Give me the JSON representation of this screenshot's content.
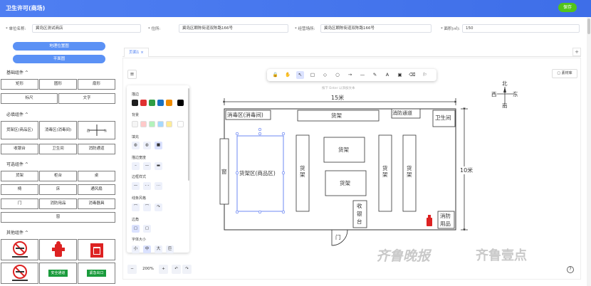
{
  "header": {
    "title": "卫生许可(商场)",
    "save_label": "保存"
  },
  "form": {
    "unit_label": "* 单位名称:",
    "unit_value": "冀岛区测试商店",
    "address_label": "* 住所:",
    "address_value": "冀岛区颗陈街道双陈路166号",
    "business_label": "* 经营场所:",
    "business_value": "冀岛区颗陈街道双陈路166号",
    "area_label": "* 面积(㎡):",
    "area_value": "150"
  },
  "left": {
    "btn_location": "地理位置图",
    "btn_plan": "平面图",
    "sec_basic": "基础组件 ^",
    "basic": [
      "矩形",
      "圆形",
      "扇形",
      "标尺",
      "文字"
    ],
    "sec_required": "必填组件 ^",
    "required": [
      "货架区(商品区)",
      "消毒区(消毒间)",
      "",
      "收银台",
      "卫生间",
      "消防通道"
    ],
    "sec_optional": "可选组件 ^",
    "optional": [
      "货架",
      "柜台",
      "桌",
      "椅",
      "床",
      "通风扇",
      "门",
      "消防用品",
      "消毒器具",
      "窗"
    ],
    "sec_other": "其他组件 ^",
    "other": [
      "禁止吸烟",
      "消火栓",
      "灭火器",
      "禁止吸烟",
      "安全通道",
      "紧急出口"
    ]
  },
  "tab": {
    "name": "页面1 ×",
    "plus": "+"
  },
  "toolbar": {
    "icons": [
      "lock-icon",
      "hand-icon",
      "pointer-icon",
      "rect-icon",
      "diamond-icon",
      "ellipse-icon",
      "arrow-icon",
      "line-icon",
      "pencil-icon",
      "text-icon",
      "image-icon",
      "eraser-icon",
      "shapes-icon"
    ],
    "glyphs": [
      "🔒",
      "✋",
      "↖",
      "□",
      "◇",
      "○",
      "→",
      "—",
      "✎",
      "A",
      "▣",
      "⌫",
      "⚐"
    ]
  },
  "hint": "按下 Enter 以添加文本",
  "library": "▢ 素材库",
  "props": {
    "stroke": "描边",
    "bg": "背景",
    "fill": "填充",
    "stroke_width": "描边宽度",
    "stroke_style": "边框样式",
    "line_style": "线条风格",
    "corner": "边角",
    "font_size": "字体大小",
    "font_opts": [
      "小",
      "中",
      "大",
      "巨"
    ],
    "stroke_colors": [
      "#1e1e1e",
      "#e03131",
      "#2f9e44",
      "#1971c2",
      "#f08c00",
      "#000000"
    ],
    "bg_colors": [
      "#f5f5f5",
      "#ffc9c9",
      "#b2f2bb",
      "#a5d8ff",
      "#ffec99",
      "#ffffff"
    ]
  },
  "zoom": {
    "minus": "−",
    "value": "200%",
    "plus": "+",
    "undo": "↶",
    "redo": "↷"
  },
  "plan": {
    "width_label": "15米",
    "height_label": "10米",
    "disinfect": "消毒区(消毒间)",
    "shelf_top": "货架",
    "fire_passage": "消防通道",
    "toilet": "卫生间",
    "window": "窗",
    "shelf_area": "货架区(商品区)",
    "shelf": "货架",
    "cashier": "收银台",
    "fire_goods": "消防用品",
    "door": "门",
    "compass": {
      "n": "北",
      "s": "南",
      "w": "西",
      "e": "东"
    }
  },
  "watermark": {
    "a": "齐鲁晚报",
    "b": "齐鲁壹点"
  }
}
